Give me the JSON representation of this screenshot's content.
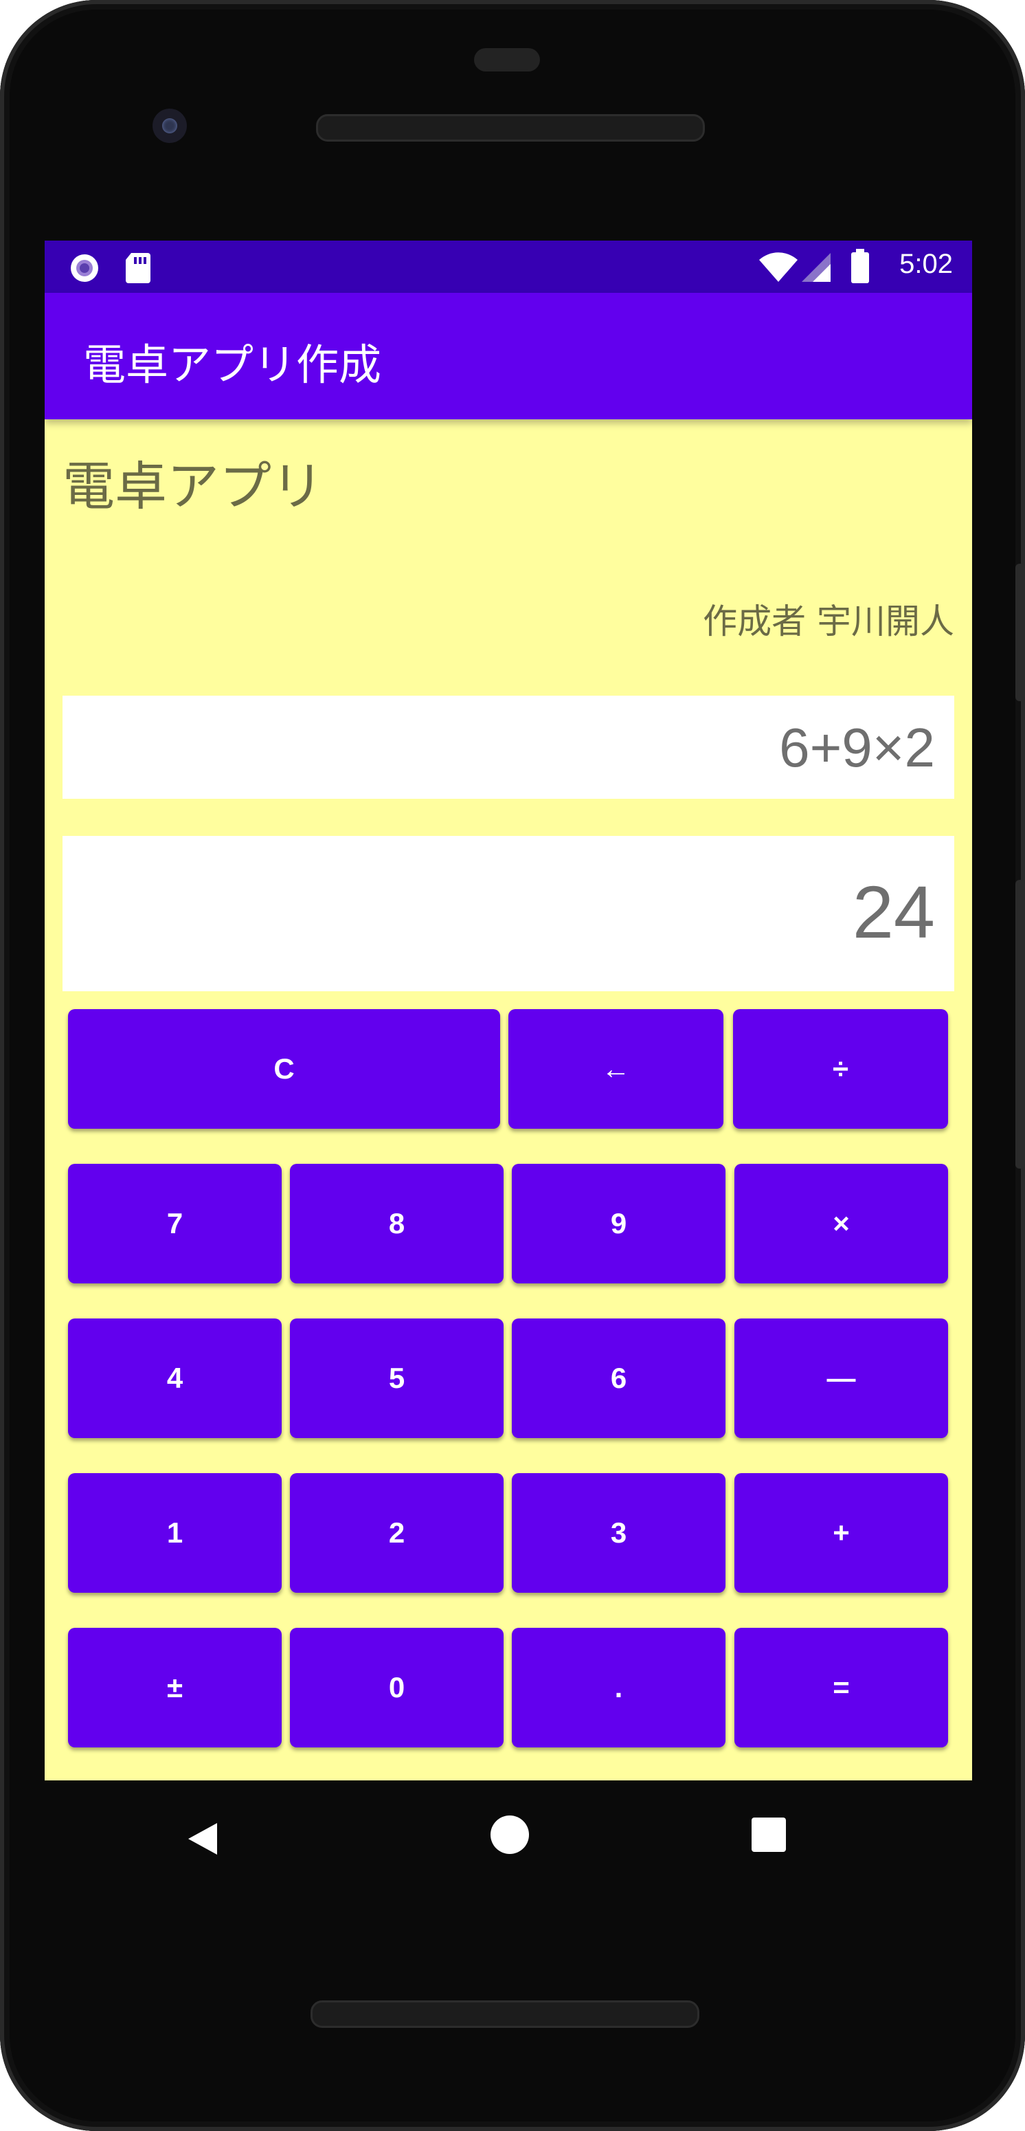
{
  "statusbar": {
    "time": "5:02",
    "icons": [
      "circle-notification-icon",
      "sd-card-icon",
      "wifi-icon",
      "cell-signal-icon",
      "battery-icon"
    ]
  },
  "appbar": {
    "title": "電卓アプリ作成"
  },
  "main": {
    "heading": "電卓アプリ",
    "author": "作成者 宇川開人",
    "expression": "6+9×2",
    "result": "24"
  },
  "keypad": {
    "rows": [
      [
        "C",
        "←",
        "÷"
      ],
      [
        "7",
        "8",
        "9",
        "×"
      ],
      [
        "4",
        "5",
        "6",
        "—"
      ],
      [
        "1",
        "2",
        "3",
        "+"
      ],
      [
        "±",
        "0",
        ".",
        "="
      ]
    ]
  },
  "navbar": {
    "icons": [
      "back-icon",
      "home-icon",
      "recents-icon"
    ]
  },
  "colors": {
    "primary": "#6200EE",
    "primary_dark": "#3700B3",
    "background": "#FFFE9E",
    "display_bg": "#FFFFFF",
    "text_muted": "#6B6B46"
  }
}
